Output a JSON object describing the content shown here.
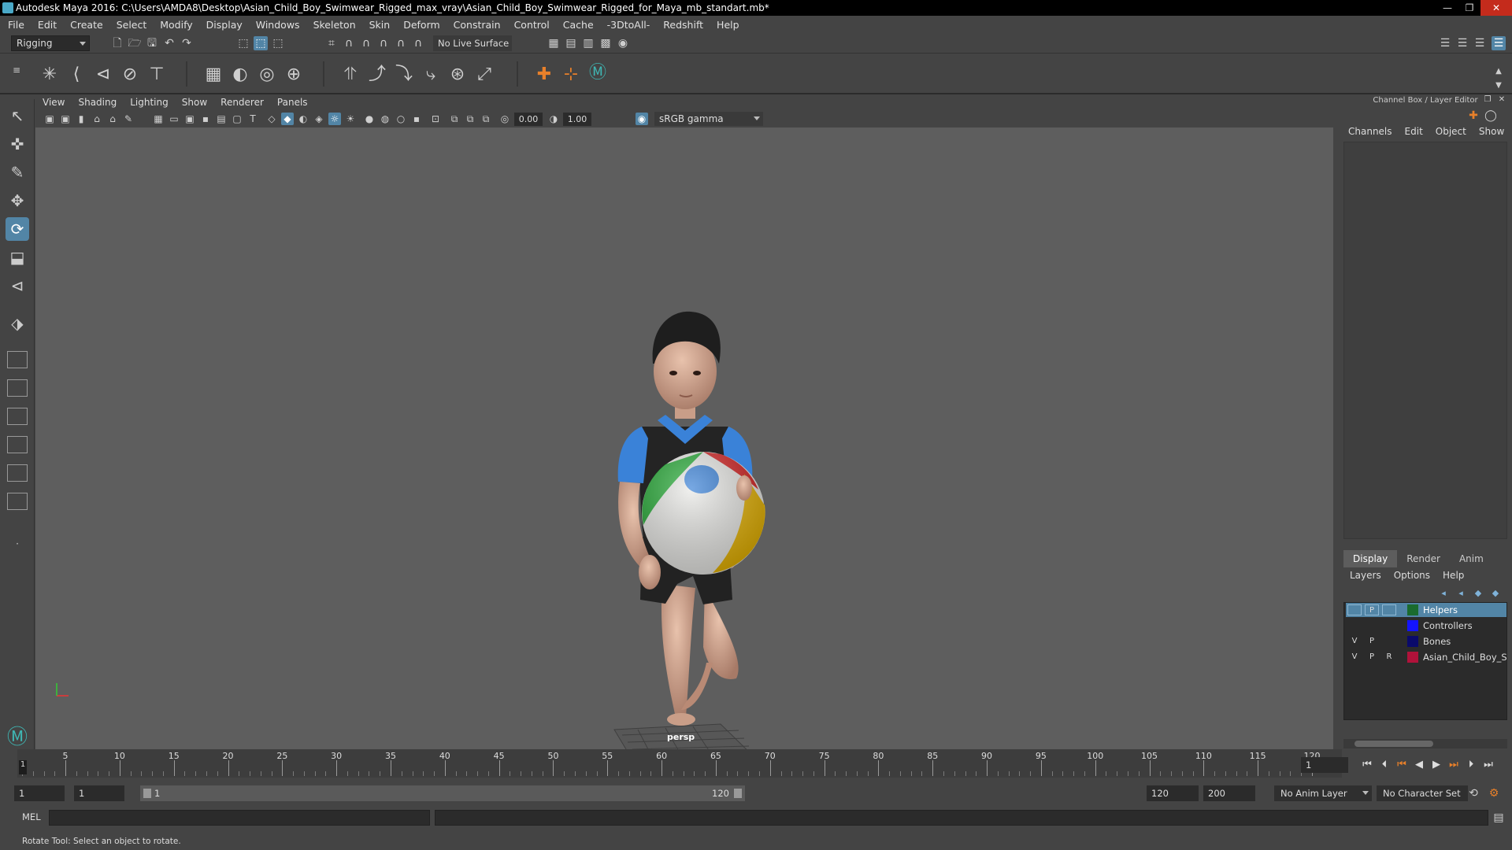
{
  "window": {
    "title": "Autodesk Maya 2016: C:\\Users\\AMDA8\\Desktop\\Asian_Child_Boy_Swimwear_Rigged_max_vray\\Asian_Child_Boy_Swimwear_Rigged_for_Maya_mb_standart.mb*",
    "minimize": "—",
    "maximize": "❐",
    "close": "✕"
  },
  "menubar": [
    "File",
    "Edit",
    "Create",
    "Select",
    "Modify",
    "Display",
    "Windows",
    "Skeleton",
    "Skin",
    "Deform",
    "Constrain",
    "Control",
    "Cache",
    "-3DtoAll-",
    "Redshift",
    "Help"
  ],
  "statusline": {
    "mode": "Rigging",
    "live_surface": "No Live Surface"
  },
  "viewport_panel": {
    "menu": [
      "View",
      "Shading",
      "Lighting",
      "Show",
      "Renderer",
      "Panels"
    ],
    "near_value": "0.00",
    "far_value": "1.00",
    "color_space": "sRGB gamma",
    "camera_label": "persp"
  },
  "channel_box": {
    "title": "Channel Box / Layer Editor",
    "menu": [
      "Channels",
      "Edit",
      "Object",
      "Show"
    ]
  },
  "layer_editor": {
    "tabs": [
      "Display",
      "Render",
      "Anim"
    ],
    "active_tab": "Display",
    "menu": [
      "Layers",
      "Options",
      "Help"
    ],
    "layers": [
      {
        "v": "",
        "p": "P",
        "r": "",
        "name": "Helpers",
        "color": "#1a6b2e",
        "selected": true
      },
      {
        "v": "",
        "p": "",
        "r": "",
        "name": "Controllers",
        "color": "#1414ff",
        "selected": false
      },
      {
        "v": "V",
        "p": "P",
        "r": "",
        "name": "Bones",
        "color": "#0a0a6b",
        "selected": false
      },
      {
        "v": "V",
        "p": "P",
        "r": "R",
        "name": "Asian_Child_Boy_Swim",
        "color": "#b0123a",
        "selected": false
      }
    ]
  },
  "timeline": {
    "ticks": [
      "5",
      "10",
      "15",
      "20",
      "25",
      "30",
      "35",
      "40",
      "45",
      "50",
      "55",
      "60",
      "65",
      "70",
      "75",
      "80",
      "85",
      "90",
      "95",
      "100",
      "105",
      "110",
      "115",
      "120"
    ],
    "current_frame_marker": "1",
    "current_frame": "1"
  },
  "range": {
    "start": "1",
    "playback_start": "1",
    "range_start_label": "1",
    "range_end_label": "120",
    "playback_end": "120",
    "end": "200",
    "anim_layer": "No Anim Layer",
    "character_set": "No Character Set"
  },
  "command_line": {
    "label": "MEL"
  },
  "help_line": "Rotate Tool: Select an object to rotate.",
  "colors": {
    "accent": "#5285a6",
    "viewport_bg": "#5e5e5e",
    "panel_bg": "#444444"
  }
}
